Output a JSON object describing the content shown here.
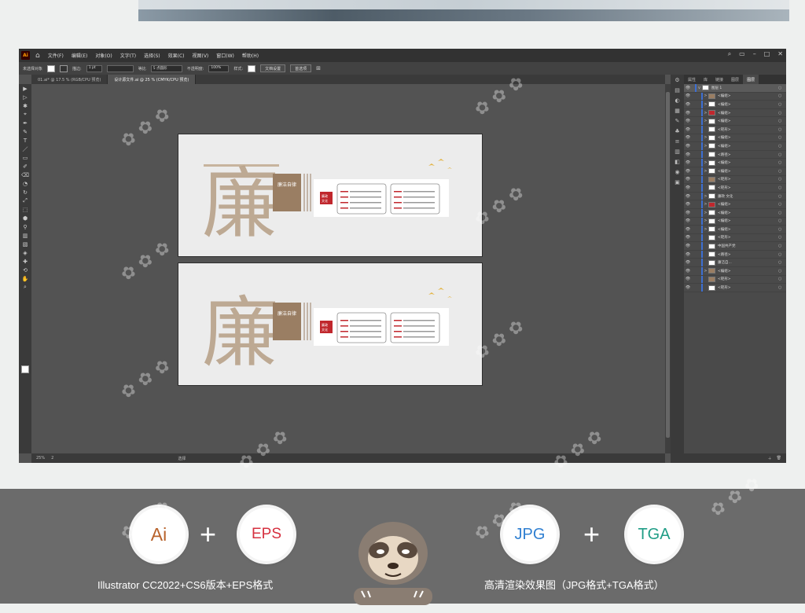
{
  "app": {
    "logo": "Ai",
    "menu": [
      "文件(F)",
      "编辑(E)",
      "对象(O)",
      "文字(T)",
      "选择(S)",
      "效果(C)",
      "视图(V)",
      "窗口(W)",
      "帮助(H)"
    ]
  },
  "control": {
    "selection": "未选择对象",
    "stroke_label": "描边:",
    "stroke_value": "1 pt",
    "brush_label": "等比",
    "brush_shape": "5 点圆形",
    "opacity_label": "不透明度:",
    "opacity_value": "100%",
    "style_label": "样式:",
    "doc_setup": "文档设置",
    "preferences": "首选项"
  },
  "tabs": [
    "01.ai* @ 17.5 % (RGB/CPU 预览)",
    "设计源文件.ai @ 25 % (CMYK/CPU 预览)"
  ],
  "status": {
    "zoom": "25%",
    "page": "2",
    "tool": "选择"
  },
  "panel": {
    "tabs": [
      "属性",
      "库",
      "链接",
      "图层",
      "图层"
    ],
    "layers": [
      {
        "name": "图层 1",
        "thumb": "#ffffff",
        "expand": "v"
      },
      {
        "name": "<编组>",
        "thumb": "#9a7e63",
        "expand": ">"
      },
      {
        "name": "<编组>",
        "thumb": "#ffffff",
        "expand": ">"
      },
      {
        "name": "<编组>",
        "thumb": "#c0272d",
        "expand": ">"
      },
      {
        "name": "<编组>",
        "thumb": "#ffffff",
        "expand": ">"
      },
      {
        "name": "<矩形>",
        "thumb": "#ffffff",
        "expand": ""
      },
      {
        "name": "<编组>",
        "thumb": "#ffffff",
        "expand": ">"
      },
      {
        "name": "<编组>",
        "thumb": "#ffffff",
        "expand": ">"
      },
      {
        "name": "<路径>",
        "thumb": "#ffffff",
        "expand": ""
      },
      {
        "name": "<编组>",
        "thumb": "#ffffff",
        "expand": ">"
      },
      {
        "name": "<编组>",
        "thumb": "#ffffff",
        "expand": ">"
      },
      {
        "name": "<矩形>",
        "thumb": "#9a7e63",
        "expand": ""
      },
      {
        "name": "<矩形>",
        "thumb": "#ffffff",
        "expand": ""
      },
      {
        "name": "廉政 文化",
        "thumb": "#ffffff",
        "expand": ">"
      },
      {
        "name": "<编组>",
        "thumb": "#c0272d",
        "expand": ">"
      },
      {
        "name": "<编组>",
        "thumb": "#ffffff",
        "expand": ">"
      },
      {
        "name": "<编组>",
        "thumb": "#ffffff",
        "expand": ">"
      },
      {
        "name": "<编组>",
        "thumb": "#ffffff",
        "expand": ">"
      },
      {
        "name": "<矩形>",
        "thumb": "#ffffff",
        "expand": ""
      },
      {
        "name": "中国共产党",
        "thumb": "#ffffff",
        "expand": ""
      },
      {
        "name": "<路径>",
        "thumb": "#ffffff",
        "expand": ""
      },
      {
        "name": "廉洁自...",
        "thumb": "#ffffff",
        "expand": ""
      },
      {
        "name": "<编组>",
        "thumb": "#9a7e63",
        "expand": ">"
      },
      {
        "name": "<矩形>",
        "thumb": "#9a7e63",
        "expand": ""
      },
      {
        "name": "<矩形>",
        "thumb": "#ffffff",
        "expand": ""
      }
    ]
  },
  "artboard": {
    "big_char": "廉",
    "vertical_text": "廉洁自律",
    "red_badge": "廉政文化",
    "card1_title": "廉洁自律准则",
    "card2_title": "党员领导干部廉洁自律规范"
  },
  "formats": {
    "left1": "Ai",
    "left2": "EPS",
    "right1": "JPG",
    "right2": "TGA",
    "plus": "+",
    "caption_left": "Illustrator CC2022+CS6版本+EPS格式",
    "caption_right": "高清渲染效果图（JPG格式+TGA格式）"
  },
  "colors": {
    "brown": "#9a7e63",
    "red": "#c0272d",
    "badge_ai": "#b8622b",
    "badge_eps": "#d6303f",
    "badge_jpg": "#2f7fd1",
    "badge_tga": "#1f9d86"
  }
}
